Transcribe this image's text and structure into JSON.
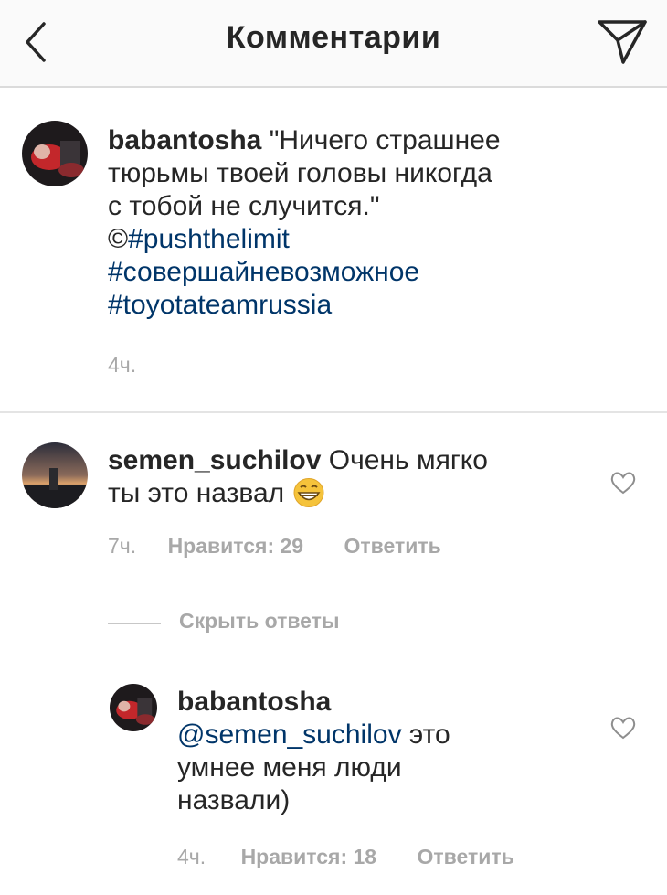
{
  "header": {
    "title": "Комментарии",
    "back_icon": "chevron-left-icon",
    "send_icon": "paper-plane-icon"
  },
  "caption": {
    "username": "babantosha",
    "text_line1": "\"Ничего страшнее",
    "text_line2": "тюрьмы твоей головы никогда",
    "text_line3": "с тобой не случится.\"",
    "copyright": "©",
    "hashtag1": "#pushthelimit",
    "hashtag2": "#совершайневозможное",
    "hashtag3": "#toyotateamrussia",
    "time": "4ч."
  },
  "comments": [
    {
      "username": "semen_suchilov",
      "text_line1": "Очень мягко",
      "text_line2": "ты это назвал",
      "emoji": "grinning-face-emoji",
      "time": "7ч.",
      "likes": "Нравится: 29",
      "reply": "Ответить"
    }
  ],
  "hide_replies": "Скрыть ответы",
  "reply": {
    "username": "babantosha",
    "mention": "@semen_suchilov",
    "text_line1": "это",
    "text_line2": "умнее меня люди",
    "text_line3": "назвали)",
    "time": "4ч.",
    "likes": "Нравится: 18",
    "reply": "Ответить"
  },
  "colors": {
    "link": "#003569",
    "meta": "#a8a8a8",
    "text": "#262626",
    "header_bg": "#fafafa"
  }
}
